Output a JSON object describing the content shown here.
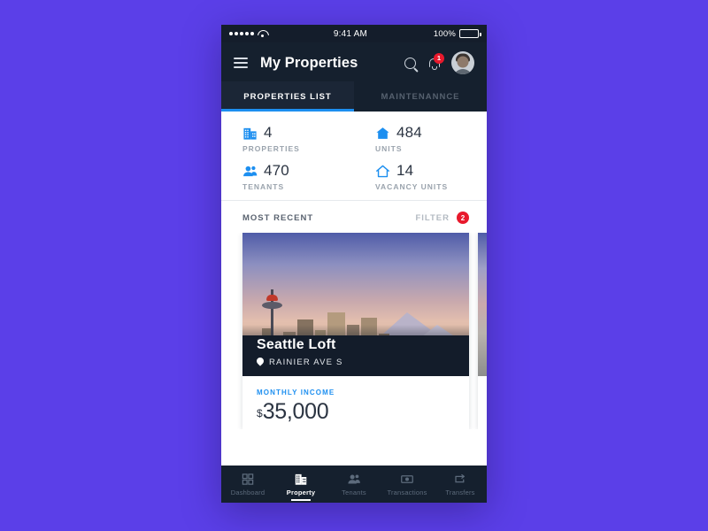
{
  "theme": {
    "page_background": "#5B3FE8",
    "header_background": "#15202e",
    "accent_blue": "#1d8ff0",
    "badge_red": "#e8192c"
  },
  "status_bar": {
    "signal_dots": 5,
    "wifi_icon": "wifi-icon",
    "time": "9:41 AM",
    "battery_percent": "100%",
    "battery_icon": "battery-full-icon"
  },
  "header": {
    "menu_icon": "hamburger-menu-icon",
    "title": "My Properties",
    "search_icon": "search-icon",
    "notifications_icon": "bell-icon",
    "notifications_count": "1",
    "avatar": "user-avatar"
  },
  "tabs": [
    {
      "label": "PROPERTIES LIST",
      "active": true
    },
    {
      "label": "MAINTENANNCE",
      "active": false
    }
  ],
  "stats": [
    {
      "icon": "building-icon",
      "value": "4",
      "label": "PROPERTIES"
    },
    {
      "icon": "home-filled-icon",
      "value": "484",
      "label": "UNITS"
    },
    {
      "icon": "tenants-icon",
      "value": "470",
      "label": "TENANTS"
    },
    {
      "icon": "home-outline-icon",
      "value": "14",
      "label": "VACANCY UNITS"
    }
  ],
  "recent": {
    "title": "MOST RECENT",
    "filter_label": "FILTER",
    "filter_count": "2"
  },
  "card": {
    "title": "Seattle Loft",
    "location_icon": "map-pin-icon",
    "address": "RAINIER AVE S",
    "income_label": "MONTHLY INCOME",
    "currency": "$",
    "income_value": "35,000"
  },
  "bottom_nav": [
    {
      "icon": "grid-icon",
      "label": "Dashboard",
      "active": false
    },
    {
      "icon": "building-icon",
      "label": "Property",
      "active": true
    },
    {
      "icon": "tenants-icon",
      "label": "Tenants",
      "active": false
    },
    {
      "icon": "banknote-icon",
      "label": "Transactions",
      "active": false
    },
    {
      "icon": "transfer-arrows-icon",
      "label": "Transfers",
      "active": false
    }
  ]
}
